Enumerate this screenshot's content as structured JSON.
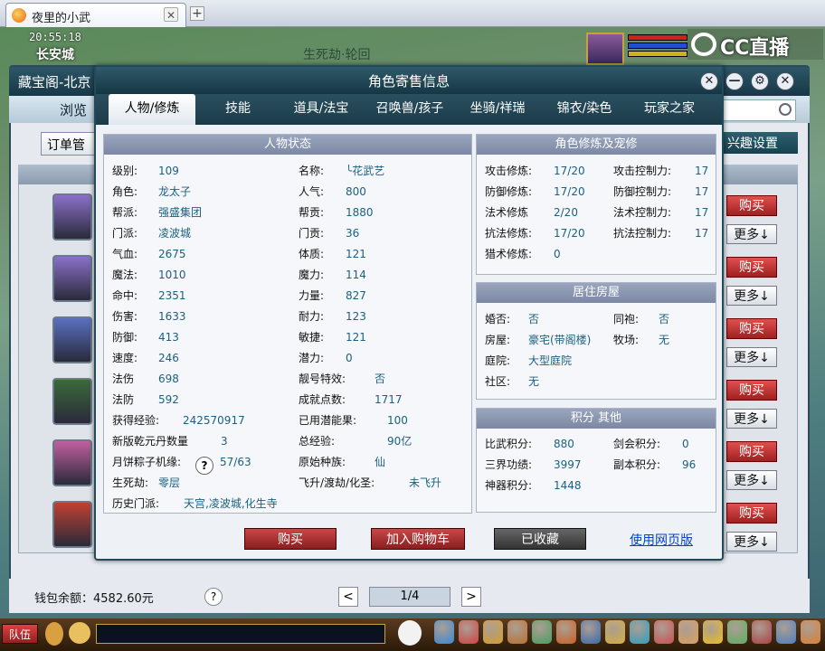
{
  "browser": {
    "tab_title": "夜里的小武",
    "tab_close": "✕",
    "new_tab": "+"
  },
  "game": {
    "time": "20:55:18",
    "city": "长安城",
    "scene_title": "生死劫·轮回",
    "cc_brand": "CC直播",
    "team_label": "队伍"
  },
  "store": {
    "title": "藏宝阁-北京",
    "browse": "浏览",
    "order_button": "订单管",
    "interest_button": "兴趣设置",
    "buy_label": "购买",
    "more_label": "更多↓",
    "wallet": "钱包余额：4582.60元",
    "wallet_help": "?",
    "page_prev": "<",
    "page": "1/4",
    "page_next": ">"
  },
  "dialog": {
    "title": "角色寄售信息",
    "controls": {
      "close": "✕",
      "minimize": "—",
      "settings": "⚙",
      "close2": "✕"
    },
    "tabs": [
      "人物/修炼",
      "技能",
      "道具/法宝",
      "召唤兽/孩子",
      "坐骑/祥瑞",
      "锦衣/染色",
      "玩家之家"
    ],
    "status_panel": {
      "title": "人物状态",
      "left": [
        {
          "label": "级别:",
          "value": "109"
        },
        {
          "label": "角色:",
          "value": "龙太子"
        },
        {
          "label": "帮派:",
          "value": "强盛集团"
        },
        {
          "label": "门派:",
          "value": "凌波城"
        },
        {
          "label": "气血:",
          "value": "2675"
        },
        {
          "label": "魔法:",
          "value": "1010"
        },
        {
          "label": "命中:",
          "value": "2351"
        },
        {
          "label": "伤害:",
          "value": "1633"
        },
        {
          "label": "防御:",
          "value": "413"
        },
        {
          "label": "速度:",
          "value": "246"
        },
        {
          "label": "法伤",
          "value": "698"
        },
        {
          "label": "法防",
          "value": "592"
        },
        {
          "label": "获得经验:",
          "value": "242570917"
        },
        {
          "label": "新版乾元丹数量",
          "value": "3"
        },
        {
          "label": "月饼粽子机缘:",
          "value": "57/63"
        },
        {
          "label": "生死劫:",
          "value": "零层"
        },
        {
          "label": "历史门派:",
          "value": "天宫,凌波城,化生寺"
        }
      ],
      "right": [
        {
          "label": "名称:",
          "value": "╰花武艺"
        },
        {
          "label": "人气:",
          "value": "800"
        },
        {
          "label": "帮贡:",
          "value": "1880"
        },
        {
          "label": "门贡:",
          "value": "36"
        },
        {
          "label": "体质:",
          "value": "121"
        },
        {
          "label": "魔力:",
          "value": "114"
        },
        {
          "label": "力量:",
          "value": "827"
        },
        {
          "label": "耐力:",
          "value": "123"
        },
        {
          "label": "敏捷:",
          "value": "121"
        },
        {
          "label": "潜力:",
          "value": "0"
        },
        {
          "label": "靓号特效:",
          "value": "否"
        },
        {
          "label": "成就点数:",
          "value": "1717"
        },
        {
          "label": "已用潜能果:",
          "value": "100"
        },
        {
          "label": "总经验:",
          "value": "90亿"
        },
        {
          "label": "原始种族:",
          "value": "仙"
        },
        {
          "label": "飞升/渡劫/化圣:",
          "value": "未飞升"
        }
      ],
      "help_icon": "?"
    },
    "cultivation_panel": {
      "title": "角色修炼及宠修",
      "left": [
        {
          "label": "攻击修炼:",
          "value": "17/20"
        },
        {
          "label": "防御修炼:",
          "value": "17/20"
        },
        {
          "label": "法术修炼",
          "value": "2/20"
        },
        {
          "label": "抗法修炼:",
          "value": "17/20"
        },
        {
          "label": "猎术修炼:",
          "value": "0"
        }
      ],
      "right": [
        {
          "label": "攻击控制力:",
          "value": "17"
        },
        {
          "label": "防御控制力:",
          "value": "17"
        },
        {
          "label": "法术控制力:",
          "value": "17"
        },
        {
          "label": "抗法控制力:",
          "value": "17"
        }
      ]
    },
    "house_panel": {
      "title": "居住房屋",
      "left": [
        {
          "label": "婚否:",
          "value": "否"
        },
        {
          "label": "房屋:",
          "value": "豪宅(带阁楼)"
        },
        {
          "label": "庭院:",
          "value": "大型庭院"
        },
        {
          "label": "社区:",
          "value": "无"
        }
      ],
      "right": [
        {
          "label": "同袍:",
          "value": "否"
        },
        {
          "label": "牧场:",
          "value": "无"
        }
      ]
    },
    "score_panel": {
      "title": "积分 其他",
      "left": [
        {
          "label": "比武积分:",
          "value": "880"
        },
        {
          "label": "三界功绩:",
          "value": "3997"
        },
        {
          "label": "神器积分:",
          "value": "1448"
        }
      ],
      "right": [
        {
          "label": "剑会积分:",
          "value": "0"
        },
        {
          "label": "副本积分:",
          "value": "96"
        }
      ]
    },
    "actions": {
      "buy": "购买",
      "add_cart": "加入购物车",
      "collected": "已收藏",
      "web_version": "使用网页版"
    }
  }
}
